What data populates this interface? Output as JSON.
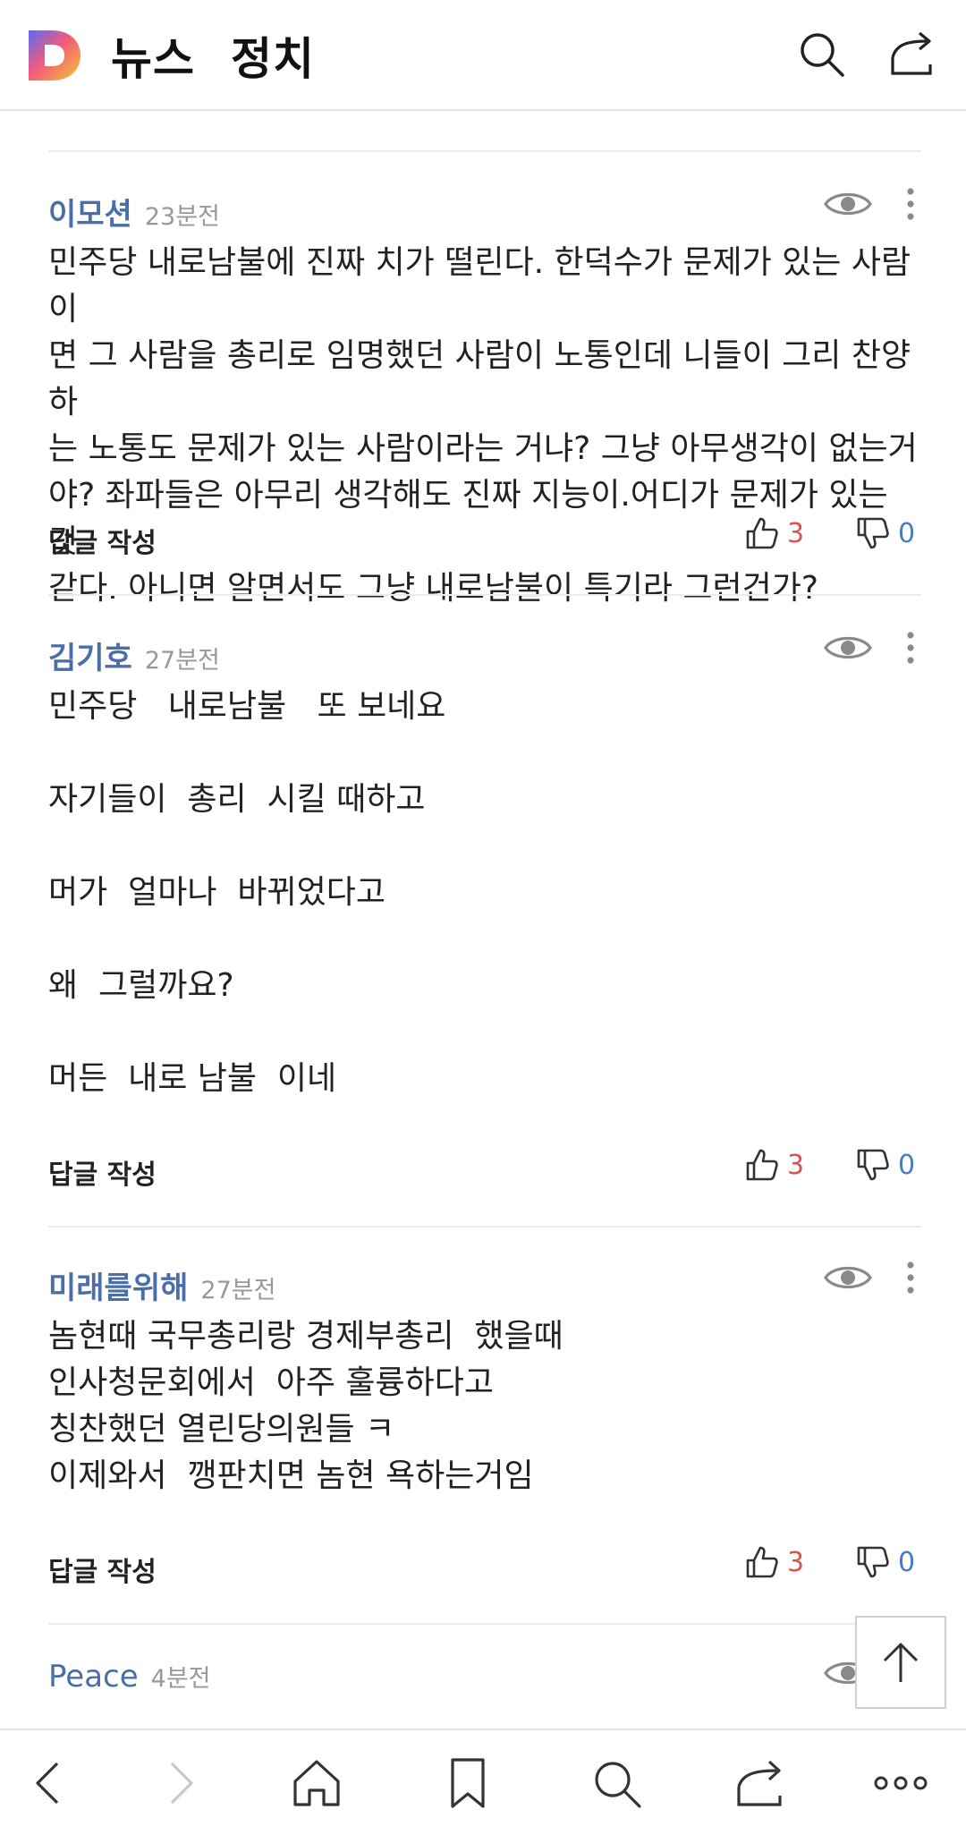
{
  "header": {
    "app_name": "뉴스",
    "section": "정치",
    "logo_icon": "daum-d-logo",
    "search_icon": "search-icon",
    "share_icon": "share-icon"
  },
  "colors": {
    "author": "#4a6ea8",
    "like_count": "#d9534f",
    "dislike_count": "#4a7cc2",
    "divider": "#ececec"
  },
  "comments": [
    {
      "author": "이모션",
      "time": "23분전",
      "text": "민주당 내로남불에 진짜 치가 떨린다. 한덕수가 문제가 있는 사람이\n면 그 사람을 총리로 임명했던 사람이 노통인데 니들이 그리 찬양하\n는 노통도 문제가 있는 사람이라는 거냐? 그냥 아무생각이 없는거\n야? 좌파들은 아무리 생각해도 진짜 지능이.어디가 문제가 있는 것\n같다. 아니면 알면서도 그냥 내로남불이 특기라 그런건가?",
      "reply_label": "답글 작성",
      "likes": "3",
      "dislikes": "0"
    },
    {
      "author": "김기호",
      "time": "27분전",
      "text": "민주당   내로남불   또 보네요\n\n자기들이  총리  시킬 때하고\n\n머가  얼마나  바뀌었다고\n\n왜  그럴까요?\n\n머든  내로 남불  이네",
      "reply_label": "답글 작성",
      "likes": "3",
      "dislikes": "0"
    },
    {
      "author": "미래를위해",
      "time": "27분전",
      "text": "놈현때 국무총리랑 경제부총리  했을때\n인사청문회에서  아주 훌륭하다고\n칭찬했던 열린당의원들 ㅋ\n이제와서  깽판치면 놈현 욕하는거임",
      "reply_label": "답글 작성",
      "likes": "3",
      "dislikes": "0"
    },
    {
      "author": "Peace",
      "time": "4분전"
    }
  ],
  "scroll_top_icon": "arrow-up-icon",
  "bottom_nav": [
    {
      "name": "back-icon"
    },
    {
      "name": "forward-icon"
    },
    {
      "name": "home-icon"
    },
    {
      "name": "bookmark-icon"
    },
    {
      "name": "search-icon"
    },
    {
      "name": "share-icon"
    },
    {
      "name": "more-icon"
    }
  ]
}
